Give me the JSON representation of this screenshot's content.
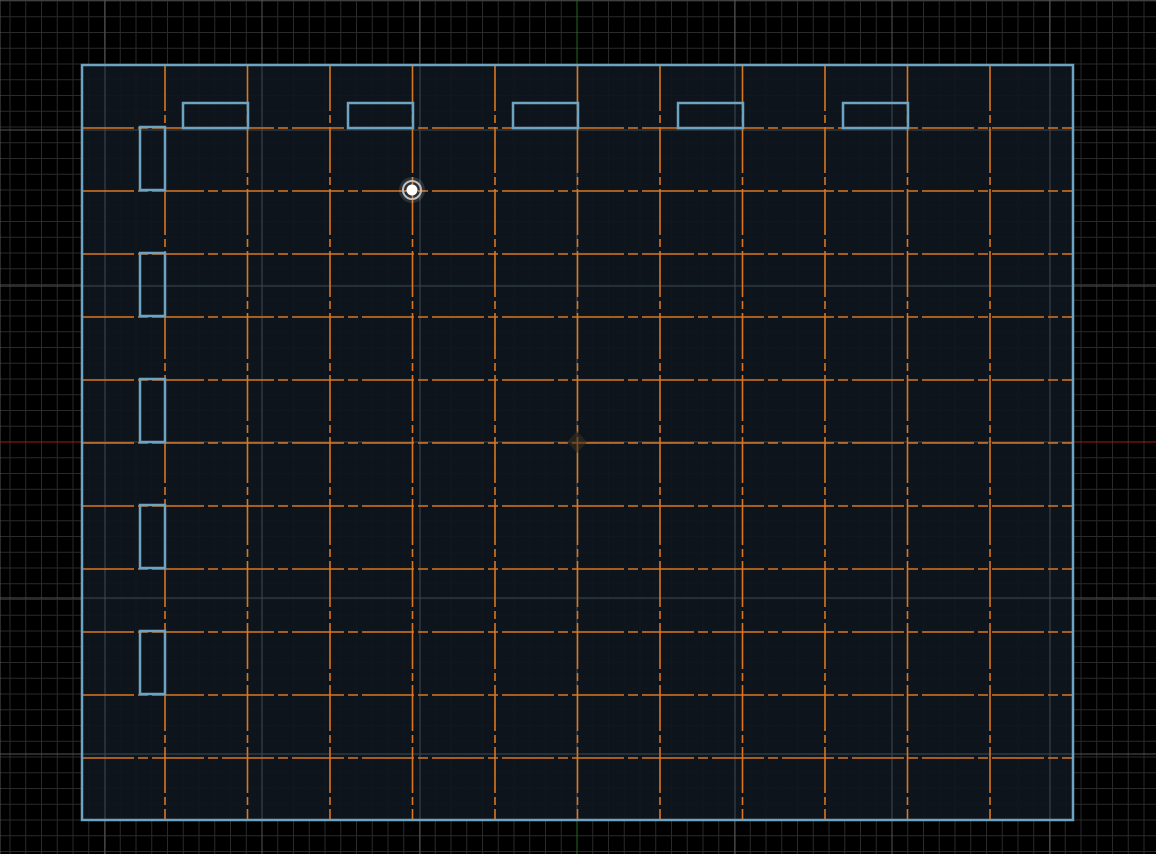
{
  "app": {
    "kind": "2D layout editor canvas (empty text UI)"
  },
  "colors": {
    "background": "#000000",
    "minor_grid": "#2a2a2a",
    "major_grid": "#555555",
    "x_axis": "#9a1d1d",
    "y_axis": "#1f6a1f",
    "room_fill": "#0f161d",
    "room_stroke": "#6fa3c2",
    "guide_line": "#d9761f",
    "marker_fill": "#ffffff"
  },
  "icons": {
    "origin_marker": "origin-icon",
    "cursor_marker": "snap-point-icon"
  },
  "counts": {
    "top_openings": 5,
    "left_openings": 5,
    "vertical_guides": 11,
    "horizontal_guides": 11
  }
}
